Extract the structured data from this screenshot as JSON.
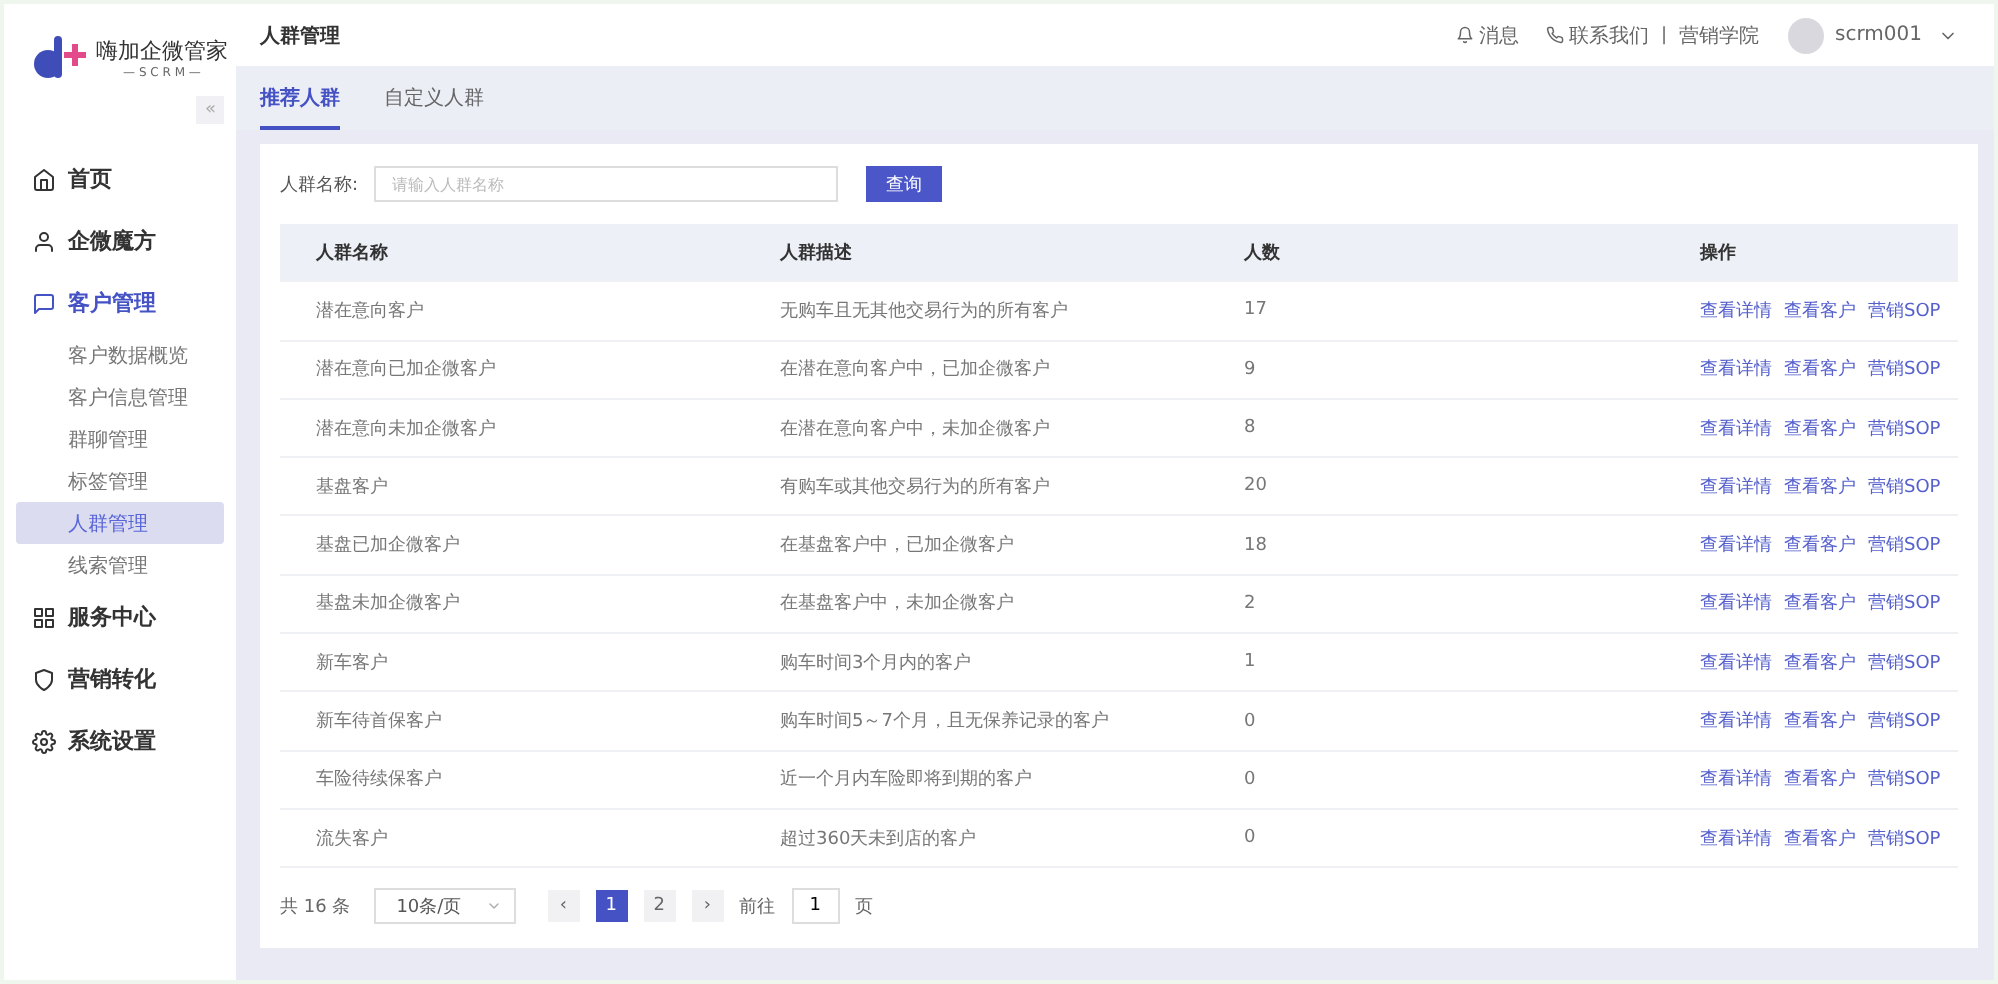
{
  "logo": {
    "name": "嗨加企微管家",
    "sub": "— S C R M —"
  },
  "sidebar": {
    "collapse": "«",
    "items": [
      {
        "label": "首页",
        "selected": false
      },
      {
        "label": "企微魔方",
        "selected": false
      },
      {
        "label": "客户管理",
        "selected": true,
        "children": [
          {
            "label": "客户数据概览",
            "selected": false
          },
          {
            "label": "客户信息管理",
            "selected": false
          },
          {
            "label": "群聊管理",
            "selected": false
          },
          {
            "label": "标签管理",
            "selected": false
          },
          {
            "label": "人群管理",
            "selected": true
          },
          {
            "label": "线索管理",
            "selected": false
          }
        ]
      },
      {
        "label": "服务中心",
        "selected": false
      },
      {
        "label": "营销转化",
        "selected": false
      },
      {
        "label": "系统设置",
        "selected": false
      }
    ]
  },
  "header": {
    "title": "人群管理",
    "messages": "消息",
    "contact": "联系我们",
    "separator": "|",
    "academy": "营销学院",
    "user": "scrm001"
  },
  "tabs": [
    {
      "label": "推荐人群",
      "selected": true
    },
    {
      "label": "自定义人群",
      "selected": false
    }
  ],
  "search": {
    "label": "人群名称:",
    "placeholder": "请输入人群名称",
    "button": "查询"
  },
  "table": {
    "columns": [
      "人群名称",
      "人群描述",
      "人数",
      "操作"
    ],
    "rows": [
      {
        "name": "潜在意向客户",
        "desc": "无购车且无其他交易行为的所有客户",
        "count": "17",
        "actions": [
          "查看详情",
          "查看客户",
          "营销SOP"
        ]
      },
      {
        "name": "潜在意向已加企微客户",
        "desc": "在潜在意向客户中，已加企微客户",
        "count": "9",
        "actions": [
          "查看详情",
          "查看客户",
          "营销SOP"
        ]
      },
      {
        "name": "潜在意向未加企微客户",
        "desc": "在潜在意向客户中，未加企微客户",
        "count": "8",
        "actions": [
          "查看详情",
          "查看客户",
          "营销SOP"
        ]
      },
      {
        "name": "基盘客户",
        "desc": "有购车或其他交易行为的所有客户",
        "count": "20",
        "actions": [
          "查看详情",
          "查看客户",
          "营销SOP"
        ]
      },
      {
        "name": "基盘已加企微客户",
        "desc": "在基盘客户中，已加企微客户",
        "count": "18",
        "actions": [
          "查看详情",
          "查看客户",
          "营销SOP"
        ]
      },
      {
        "name": "基盘未加企微客户",
        "desc": "在基盘客户中，未加企微客户",
        "count": "2",
        "actions": [
          "查看详情",
          "查看客户",
          "营销SOP"
        ]
      },
      {
        "name": "新车客户",
        "desc": "购车时间3个月内的客户",
        "count": "1",
        "actions": [
          "查看详情",
          "查看客户",
          "营销SOP"
        ]
      },
      {
        "name": "新车待首保客户",
        "desc": "购车时间5～7个月，且无保养记录的客户",
        "count": "0",
        "actions": [
          "查看详情",
          "查看客户",
          "营销SOP"
        ]
      },
      {
        "name": "车险待续保客户",
        "desc": "近一个月内车险即将到期的客户",
        "count": "0",
        "actions": [
          "查看详情",
          "查看客户",
          "营销SOP"
        ]
      },
      {
        "name": "流失客户",
        "desc": "超过360天未到店的客户",
        "count": "0",
        "actions": [
          "查看详情",
          "查看客户",
          "营销SOP"
        ]
      }
    ]
  },
  "pagination": {
    "total": "共 16 条",
    "page_size": "10条/页",
    "prev": "‹",
    "next": "›",
    "pages": [
      {
        "label": "1",
        "selected": true
      },
      {
        "label": "2",
        "selected": false
      }
    ],
    "goto_label": "前往",
    "goto_value": "1",
    "goto_suffix": "页"
  }
}
